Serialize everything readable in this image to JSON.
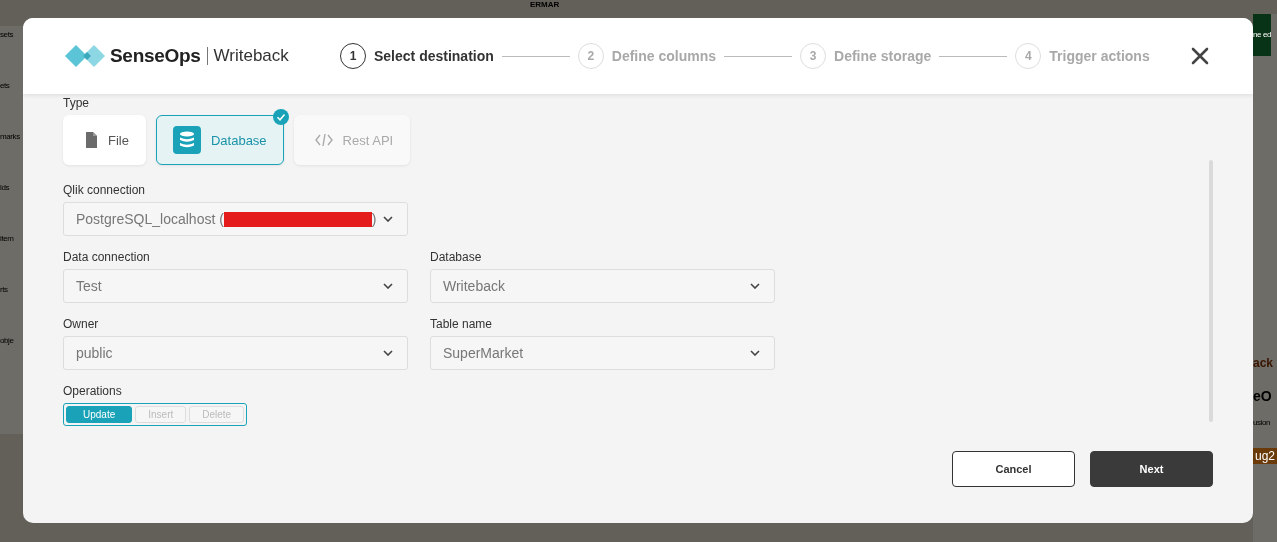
{
  "backdrop": {
    "top_text": "ERMAR",
    "sidebar": [
      "sets",
      "ets",
      "marks",
      "lds",
      "item",
      "rts",
      "obje"
    ],
    "right": [
      "ne ed",
      "ack",
      "eO",
      "usion",
      "ug2"
    ]
  },
  "dialog": {
    "brand": "SenseOps",
    "product": "Writeback",
    "steps": [
      {
        "number": "1",
        "label": "Select destination",
        "selected": true
      },
      {
        "number": "2",
        "label": "Define columns",
        "selected": false
      },
      {
        "number": "3",
        "label": "Define storage",
        "selected": false
      },
      {
        "number": "4",
        "label": "Trigger actions",
        "selected": false
      }
    ],
    "type_label": "Type",
    "types": [
      {
        "kind": "file",
        "label": "File",
        "selected": false,
        "disabled": false
      },
      {
        "kind": "database",
        "label": "Database",
        "selected": true,
        "disabled": false
      },
      {
        "kind": "api",
        "label": "Rest API",
        "selected": false,
        "disabled": true
      }
    ],
    "qlik_connection": {
      "label": "Qlik connection",
      "value_prefix": "PostgreSQL_localhost (",
      "value_suffix": ")",
      "redacted": true
    },
    "fields": [
      {
        "label": "Data connection",
        "value": "Test"
      },
      {
        "label": "Database",
        "value": "Writeback"
      },
      {
        "label": "Owner",
        "value": "public"
      },
      {
        "label": "Table name",
        "value": "SuperMarket"
      }
    ],
    "operations_label": "Operations",
    "operations": [
      {
        "label": "Update",
        "selected": true
      },
      {
        "label": "Insert",
        "selected": false
      },
      {
        "label": "Delete",
        "selected": false
      }
    ],
    "buttons": [
      {
        "kind": "secondary",
        "label": "Cancel"
      },
      {
        "kind": "primary",
        "label": "Next"
      }
    ]
  }
}
